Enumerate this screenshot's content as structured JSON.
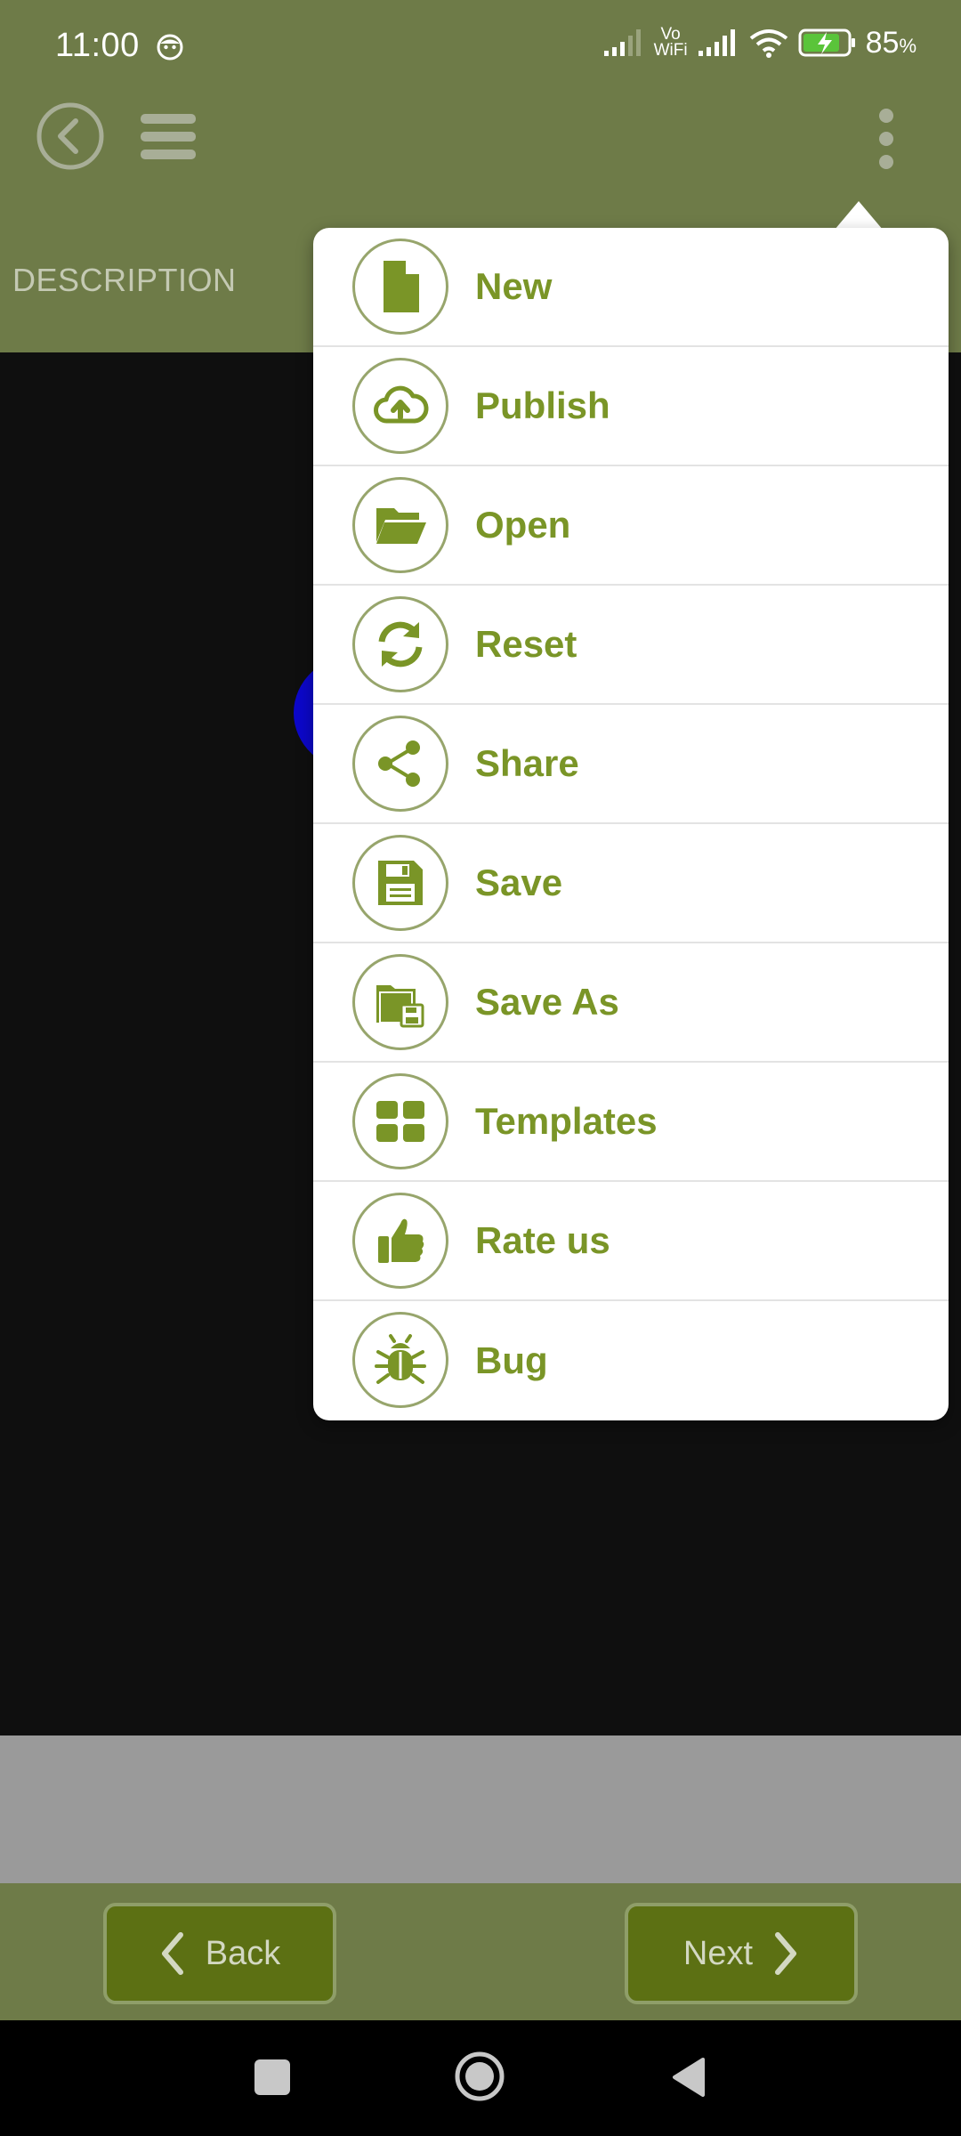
{
  "status_bar": {
    "time": "11:00",
    "network_label_top": "Vo",
    "network_label_bottom": "WiFi",
    "battery_percent": "85",
    "battery_unit": "%",
    "battery_level": 0.85,
    "icons": [
      "face-notification-icon",
      "signal-icon",
      "vowifi-icon",
      "signal-icon",
      "wifi-icon",
      "battery-charging-icon"
    ]
  },
  "app_bar": {
    "tab_label": "DESCRIPTION",
    "icons": [
      "back-circle-icon",
      "hamburger-menu-icon",
      "overflow-menu-icon"
    ]
  },
  "menu": {
    "items": [
      {
        "label": "New",
        "icon": "new-file-icon"
      },
      {
        "label": "Publish",
        "icon": "cloud-upload-icon"
      },
      {
        "label": "Open",
        "icon": "folder-open-icon"
      },
      {
        "label": "Reset",
        "icon": "refresh-icon"
      },
      {
        "label": "Share",
        "icon": "share-icon"
      },
      {
        "label": "Save",
        "icon": "save-floppy-icon"
      },
      {
        "label": "Save As",
        "icon": "save-as-icon"
      },
      {
        "label": "Templates",
        "icon": "grid-icon"
      },
      {
        "label": "Rate us",
        "icon": "thumbs-up-icon"
      },
      {
        "label": "Bug",
        "icon": "bug-icon"
      }
    ]
  },
  "footer": {
    "back_label": "Back",
    "next_label": "Next"
  },
  "colors": {
    "bar": "#6e7b48",
    "accent": "#7a9527",
    "button": "#5c7013",
    "canvas": "#0f0f0f",
    "shape": "#0c07c9",
    "strip": "#9a9a9a"
  }
}
